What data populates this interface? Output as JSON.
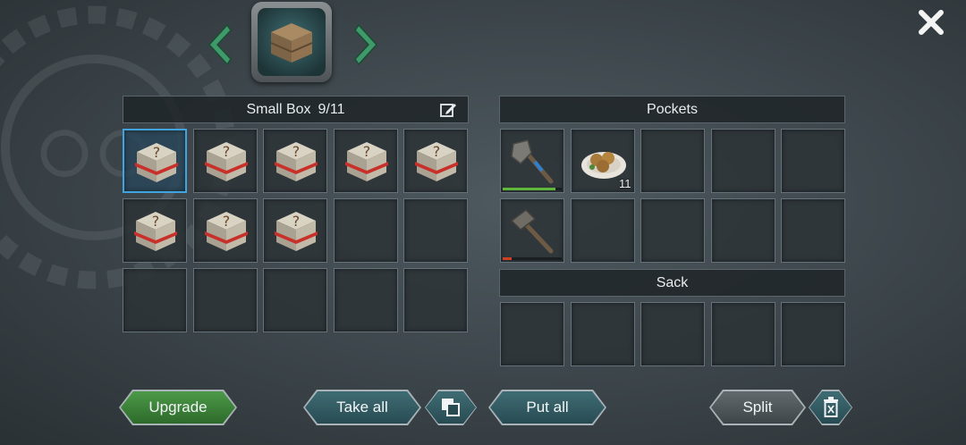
{
  "header": {
    "container_icon": "wooden-crate-icon",
    "prev_icon": "chevron-left-icon",
    "next_icon": "chevron-right-icon",
    "close_icon": "close-icon"
  },
  "box_panel": {
    "title": "Small Box",
    "capacity": "9/11",
    "edit_icon": "edit-icon",
    "slots": [
      {
        "item": "mystery-crate",
        "selected": true
      },
      {
        "item": "mystery-crate"
      },
      {
        "item": "mystery-crate"
      },
      {
        "item": "mystery-crate"
      },
      {
        "item": "mystery-crate"
      },
      {
        "item": "mystery-crate"
      },
      {
        "item": "mystery-crate"
      },
      {
        "item": "mystery-crate"
      },
      {},
      {},
      {},
      {},
      {},
      {},
      {}
    ]
  },
  "pockets_panel": {
    "title": "Pockets",
    "slots": [
      {
        "item": "stone-axe",
        "durability": 0.9,
        "durability_color": "#5fb83a",
        "secondary_color": "#2f7fd0"
      },
      {
        "item": "baked-food-plate",
        "count": "11"
      },
      {},
      {},
      {},
      {
        "item": "stone-hammer",
        "durability": 0.15,
        "durability_color": "#d04020"
      },
      {},
      {},
      {},
      {}
    ]
  },
  "sack_panel": {
    "title": "Sack",
    "slots": [
      {},
      {},
      {},
      {},
      {}
    ]
  },
  "buttons": {
    "upgrade": "Upgrade",
    "take_all": "Take all",
    "stack_icon": "stack-icon",
    "put_all": "Put all",
    "split": "Split",
    "trash_icon": "trash-icon"
  },
  "colors": {
    "selected_border": "#3fa4e0",
    "upgrade_green": "#3c8a3a",
    "action_teal": "#335c63"
  }
}
